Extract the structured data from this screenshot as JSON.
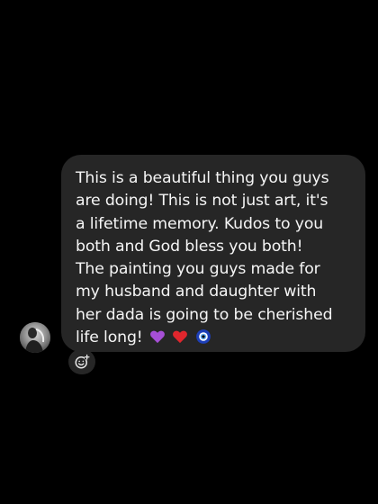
{
  "message": {
    "lines": [
      "This is a beautiful thing you guys",
      "are doing! This is not just art, it's",
      "a lifetime memory. Kudos to you",
      "both and God bless you both!",
      "The painting you guys made for",
      "my husband and daughter with",
      "her dada is going to be cherished",
      "life long!"
    ],
    "emojis": [
      "purple-heart-icon",
      "red-heart-icon",
      "nazar-amulet-icon"
    ]
  },
  "colors": {
    "background": "#000000",
    "bubble": "#262626",
    "text": "#f5f5f5"
  },
  "icons": {
    "avatar": "sender-avatar",
    "reaction": "add-reaction-icon"
  }
}
